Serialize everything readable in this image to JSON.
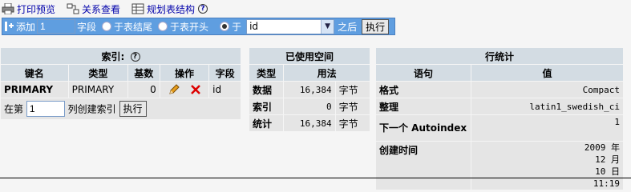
{
  "toplinks": {
    "print": "打印预览",
    "relations": "关系查看",
    "plan": "规划表结构"
  },
  "addbar": {
    "add_label": "添加",
    "field_count": "1",
    "fields_label": "字段",
    "end_label": "于表结尾",
    "start_label": "于表开头",
    "after_prefix": "于",
    "after_select": "id",
    "after_suffix": "之后",
    "execute": "执行"
  },
  "indexes": {
    "title": "索引:",
    "headers": [
      "键名",
      "类型",
      "基数",
      "操作",
      "字段"
    ],
    "row": {
      "key": "PRIMARY",
      "type": "PRIMARY",
      "cardinality": "0",
      "field": "id"
    },
    "create_prefix": "在第",
    "create_value": "1",
    "create_suffix": "列创建索引",
    "create_button": "执行"
  },
  "space": {
    "title": "已使用空间",
    "headers": [
      "类型",
      "用法"
    ],
    "rows": [
      {
        "type": "数据",
        "value": "16,384",
        "unit": "字节"
      },
      {
        "type": "索引",
        "value": "0",
        "unit": "字节"
      },
      {
        "type": "统计",
        "value": "16,384",
        "unit": "字节"
      }
    ]
  },
  "rowstats": {
    "title": "行统计",
    "headers": [
      "语句",
      "值"
    ],
    "rows": [
      {
        "label": "格式",
        "value": "Compact"
      },
      {
        "label": "整理",
        "value": "latin1_swedish_ci"
      },
      {
        "label": "下一个 Autoindex",
        "value": "1"
      },
      {
        "label": "创建时间",
        "value": "2009 年 12 月 10 日 11:19"
      }
    ]
  },
  "colors": {
    "accent": "#5f9ee0",
    "header_bg": "#d3dce3",
    "cell_bg": "#e5e5e5",
    "link": "#0000aa"
  }
}
